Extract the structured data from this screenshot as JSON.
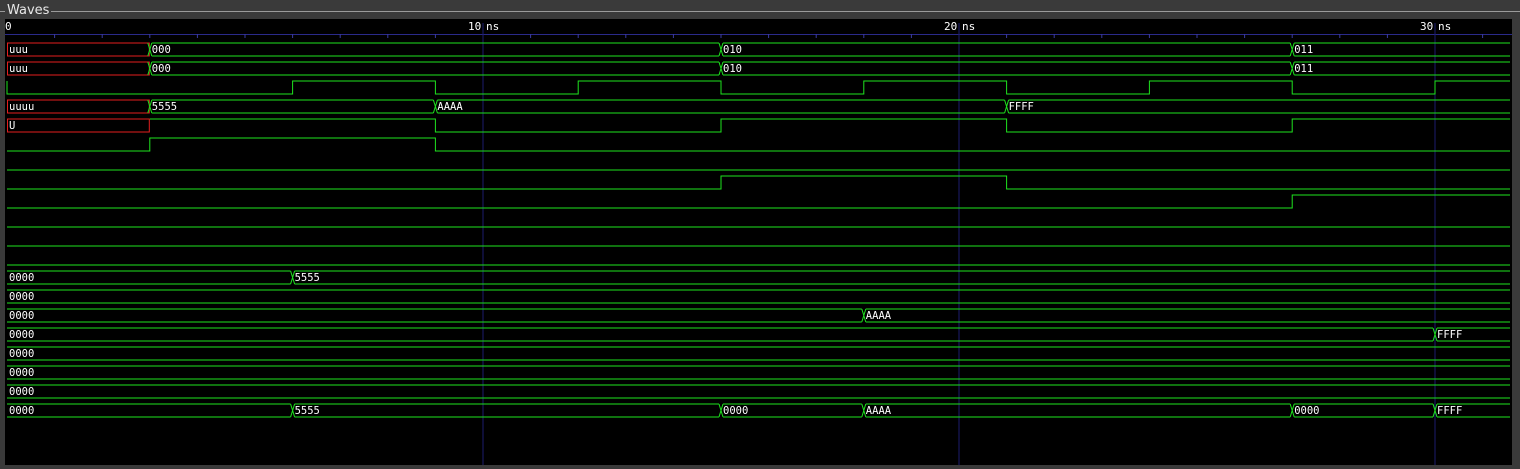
{
  "panel": {
    "title": "Waves"
  },
  "timeline": {
    "origin_label": "0",
    "unit": "ns",
    "major_ticks": [
      {
        "t": 10,
        "label": "10"
      },
      {
        "t": 20,
        "label": "20"
      },
      {
        "t": 30,
        "label": "30"
      }
    ],
    "max_time": 31.5
  },
  "colors": {
    "wave": "#1ee31e",
    "undefined": "#e31e1e",
    "grid": "#1c1c6e",
    "text": "#ffffff",
    "background": "#000000"
  },
  "signals": [
    {
      "kind": "bus",
      "segments": [
        {
          "t": 0,
          "v": "uuu",
          "u": true
        },
        {
          "t": 3,
          "v": "000"
        },
        {
          "t": 15,
          "v": "010"
        },
        {
          "t": 27,
          "v": "011"
        }
      ]
    },
    {
      "kind": "bus",
      "segments": [
        {
          "t": 0,
          "v": "uuu",
          "u": true
        },
        {
          "t": 3,
          "v": "000"
        },
        {
          "t": 15,
          "v": "010"
        },
        {
          "t": 27,
          "v": "011"
        }
      ]
    },
    {
      "kind": "bit",
      "edges": [
        {
          "t": 0,
          "v": 1
        },
        {
          "t": 0,
          "v": 0
        },
        {
          "t": 6,
          "v": 1
        },
        {
          "t": 9,
          "v": 0
        },
        {
          "t": 12,
          "v": 1
        },
        {
          "t": 15,
          "v": 0
        },
        {
          "t": 18,
          "v": 1
        },
        {
          "t": 21,
          "v": 0
        },
        {
          "t": 24,
          "v": 1
        },
        {
          "t": 27,
          "v": 0
        },
        {
          "t": 30,
          "v": 1
        }
      ]
    },
    {
      "kind": "bus",
      "segments": [
        {
          "t": 0,
          "v": "uuuu",
          "u": true
        },
        {
          "t": 3,
          "v": "5555"
        },
        {
          "t": 9,
          "v": "AAAA"
        },
        {
          "t": 21,
          "v": "FFFF"
        }
      ]
    },
    {
      "kind": "bit",
      "edges": [
        {
          "t": 0,
          "v": "U"
        },
        {
          "t": 3,
          "v": 1
        },
        {
          "t": 9,
          "v": 0
        },
        {
          "t": 15,
          "v": 1
        },
        {
          "t": 21,
          "v": 0
        },
        {
          "t": 27,
          "v": 1
        }
      ]
    },
    {
      "kind": "bit",
      "edges": [
        {
          "t": 0,
          "v": 0
        },
        {
          "t": 3,
          "v": 1
        },
        {
          "t": 9,
          "v": 0
        }
      ]
    },
    {
      "kind": "bit",
      "edges": [
        {
          "t": 0,
          "v": 0
        }
      ]
    },
    {
      "kind": "bit",
      "edges": [
        {
          "t": 0,
          "v": 0
        },
        {
          "t": 15,
          "v": 1
        },
        {
          "t": 21,
          "v": 0
        }
      ]
    },
    {
      "kind": "bit",
      "edges": [
        {
          "t": 0,
          "v": 0
        },
        {
          "t": 27,
          "v": 1
        }
      ]
    },
    {
      "kind": "bit",
      "edges": [
        {
          "t": 0,
          "v": 0
        }
      ]
    },
    {
      "kind": "bit",
      "edges": [
        {
          "t": 0,
          "v": 0
        }
      ]
    },
    {
      "kind": "bit",
      "edges": [
        {
          "t": 0,
          "v": 0
        }
      ]
    },
    {
      "kind": "bus",
      "segments": [
        {
          "t": 0,
          "v": "0000"
        },
        {
          "t": 6,
          "v": "5555"
        }
      ]
    },
    {
      "kind": "bus",
      "segments": [
        {
          "t": 0,
          "v": "0000"
        }
      ]
    },
    {
      "kind": "bus",
      "segments": [
        {
          "t": 0,
          "v": "0000"
        },
        {
          "t": 18,
          "v": "AAAA"
        }
      ]
    },
    {
      "kind": "bus",
      "segments": [
        {
          "t": 0,
          "v": "0000"
        },
        {
          "t": 30,
          "v": "FFFF"
        }
      ]
    },
    {
      "kind": "bus",
      "segments": [
        {
          "t": 0,
          "v": "0000"
        }
      ]
    },
    {
      "kind": "bus",
      "segments": [
        {
          "t": 0,
          "v": "0000"
        }
      ]
    },
    {
      "kind": "bus",
      "segments": [
        {
          "t": 0,
          "v": "0000"
        }
      ]
    },
    {
      "kind": "bus",
      "segments": [
        {
          "t": 0,
          "v": "0000"
        },
        {
          "t": 6,
          "v": "5555"
        },
        {
          "t": 15,
          "v": "0000"
        },
        {
          "t": 18,
          "v": "AAAA"
        },
        {
          "t": 27,
          "v": "0000"
        },
        {
          "t": 30,
          "v": "FFFF"
        }
      ]
    }
  ]
}
